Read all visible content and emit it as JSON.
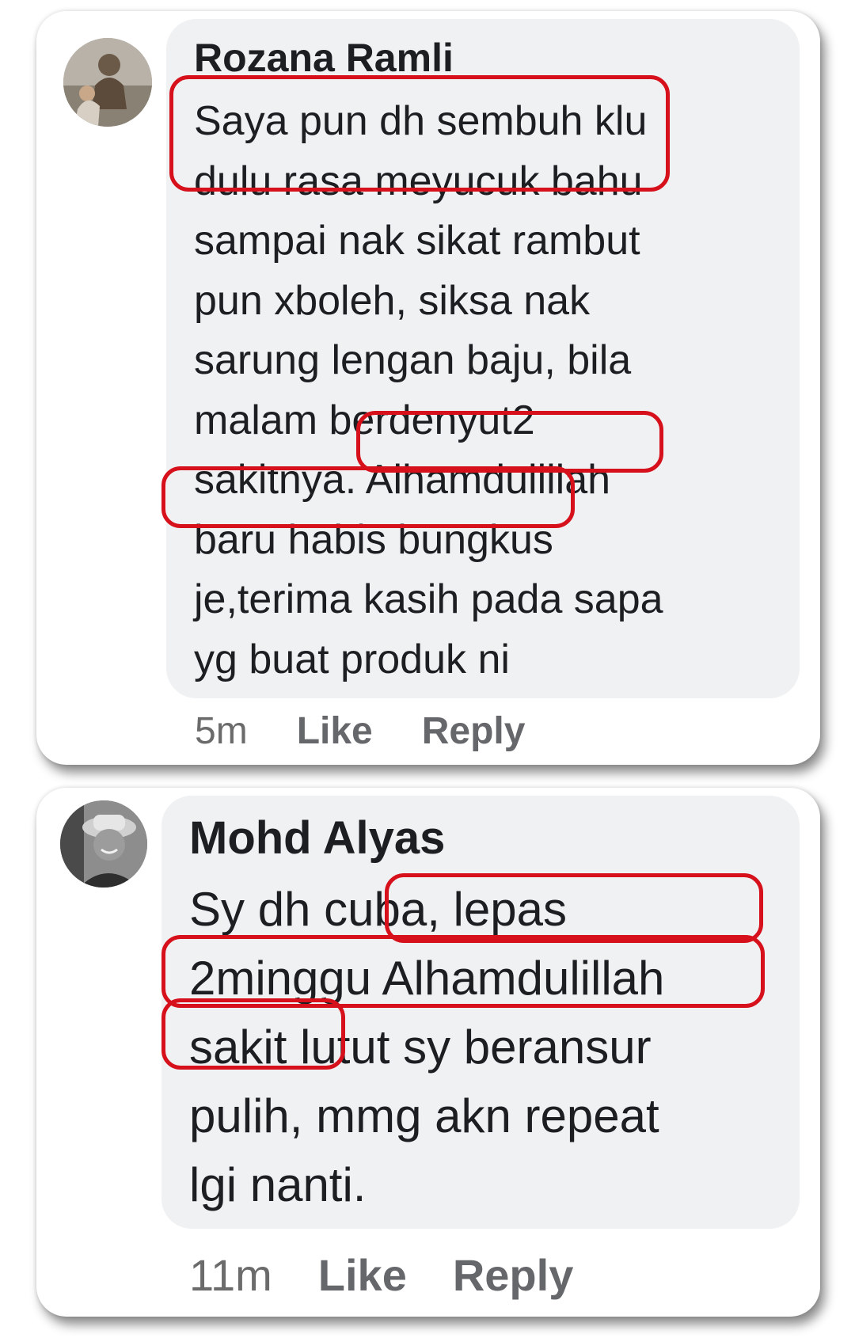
{
  "comments": [
    {
      "author": "Rozana Ramli",
      "text": "Saya pun dh sembuh klu\ndulu rasa meyucuk bahu\nsampai nak sikat rambut\npun xboleh, siksa nak\nsarung lengan baju, bila\nmalam berdenyut2\nsakitnya. Alhamdulillah\nbaru habis bungkus\nje,terima kasih pada sapa\nyg buat produk ni",
      "time": "5m",
      "like_label": "Like",
      "reply_label": "Reply"
    },
    {
      "author": "Mohd Alyas",
      "text": "Sy dh cuba, lepas\n2minggu Alhamdulillah\nsakit lutut sy beransur\npulih, mmg akn repeat\nlgi nanti.",
      "time": "11m",
      "like_label": "Like",
      "reply_label": "Reply"
    }
  ],
  "colors": {
    "highlight_border": "#d6111c",
    "bubble_bg": "#f0f1f3",
    "author_text": "#1c1e21",
    "action_text": "#65676b"
  },
  "icons": [
    "avatar-photo-rozana",
    "avatar-photo-alyas"
  ]
}
